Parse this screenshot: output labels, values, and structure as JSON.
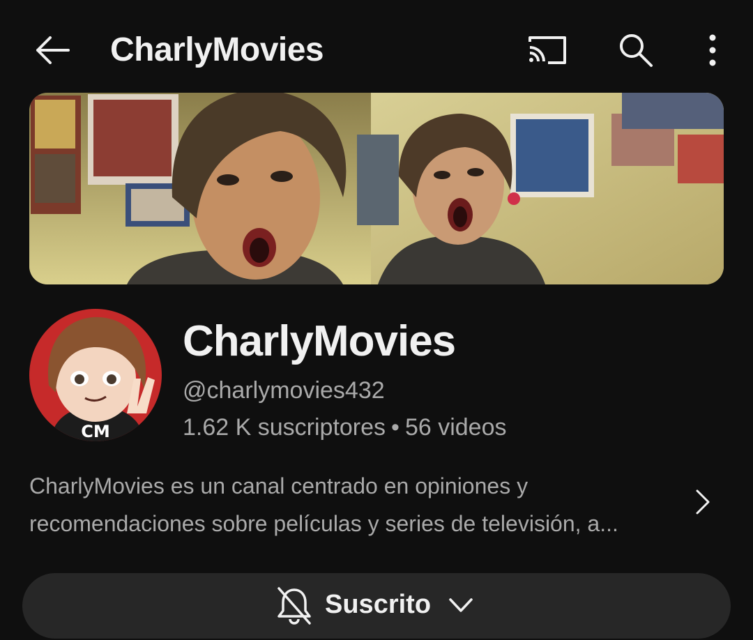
{
  "header": {
    "title": "CharlyMovies",
    "icons": [
      "back-arrow-icon",
      "cast-icon",
      "search-icon",
      "more-vert-icon"
    ]
  },
  "banner": {
    "description": "Channel banner"
  },
  "channel": {
    "name": "CharlyMovies",
    "handle": "@charlymovies432",
    "subscribers": "1.62 K suscriptores",
    "separator": "•",
    "videos": "56 videos",
    "avatar_text": "CM",
    "description": "CharlyMovies es un canal centrado en opiniones y recomendaciones sobre películas y series de televisión, a..."
  },
  "subscribe": {
    "label": "Suscrito",
    "icons": [
      "notifications-off-icon",
      "chevron-down-icon"
    ]
  },
  "colors": {
    "background": "#0f0f0f",
    "text_primary": "#f1f1f1",
    "text_secondary": "#aaaaaa",
    "button_bg": "#272727",
    "avatar_bg": "#c62a2a"
  }
}
